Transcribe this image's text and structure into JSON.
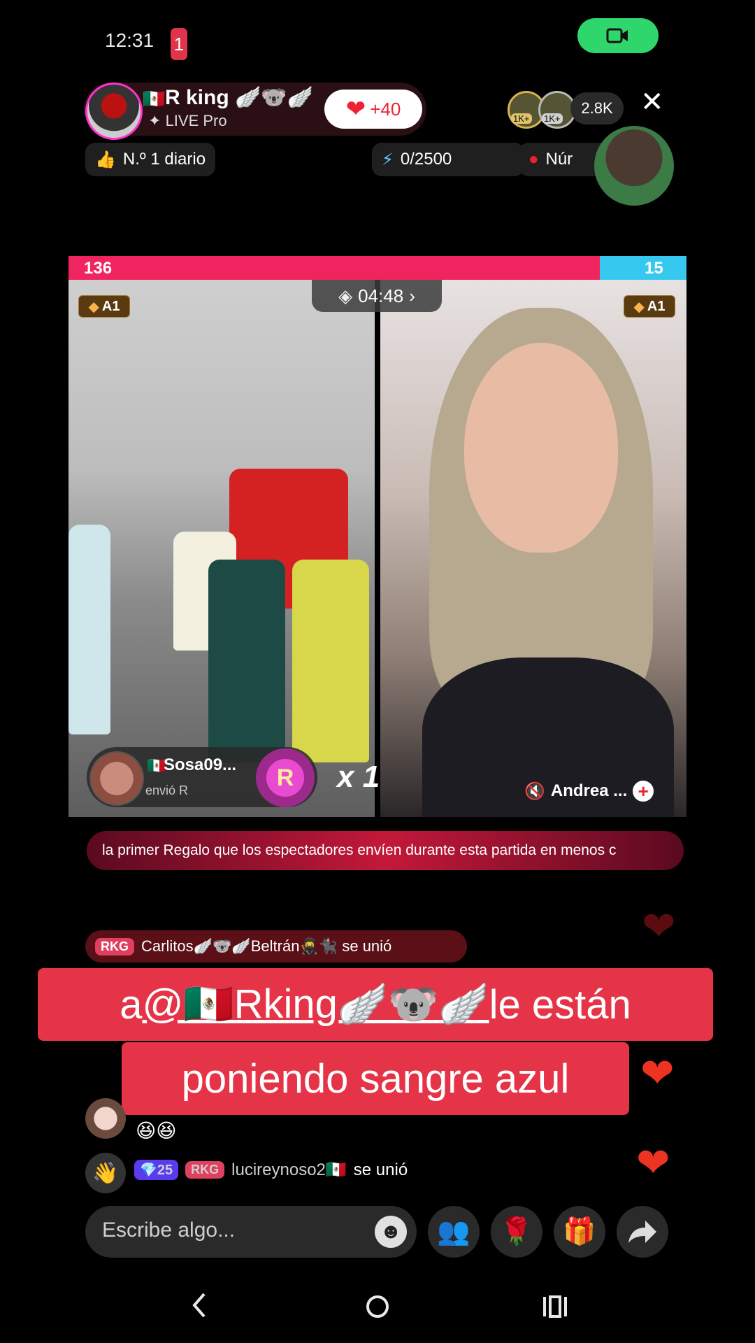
{
  "status": {
    "time": "12:31",
    "notif_count": "1"
  },
  "host": {
    "name": "R king",
    "flag": "🇲🇽",
    "badges": "🪽🐨🪽",
    "sub": "LIVE Pro",
    "likes": "+40"
  },
  "viewers": {
    "count": "2.8K",
    "badge1": "1K+",
    "badge2": "1K+"
  },
  "chips": {
    "rank": "N.º 1 diario",
    "goal": "0/2500",
    "number": "Núr"
  },
  "battle": {
    "score_left": "136",
    "score_right": "15",
    "timer": "04:48",
    "left_tag": "A1",
    "right_tag": "A1",
    "opponent_name": "Andrea ...",
    "gift_user": "Sosa09...",
    "gift_flag": "🇲🇽",
    "gift_action": "envió R",
    "gift_emblem": "R",
    "gift_mult": "x 1"
  },
  "ticker": "la primer Regalo que los espectadores envíen durante esta partida en menos c",
  "chat": {
    "join1_badge": "RKG",
    "join1_text": "Carlitos🪽🐨🪽Beltrán🥷🐈‍⬛ se unió",
    "caption_line1_pre": "a ",
    "caption_mention": "@🇲🇽Rking🪽🐨🪽",
    "caption_line1_post": " le están",
    "caption_line2": "poniendo sangre azul",
    "message_emoji": "😆😆",
    "join2_gem": "25",
    "join2_badge": "RKG",
    "join2_user": "lucireynoso2🇲🇽",
    "join2_action": "se unió"
  },
  "input": {
    "placeholder": "Escribe algo..."
  },
  "colors": {
    "accent": "#e53447",
    "green": "#2fd66b",
    "pink": "#f0245f",
    "blue": "#37c8f0"
  }
}
